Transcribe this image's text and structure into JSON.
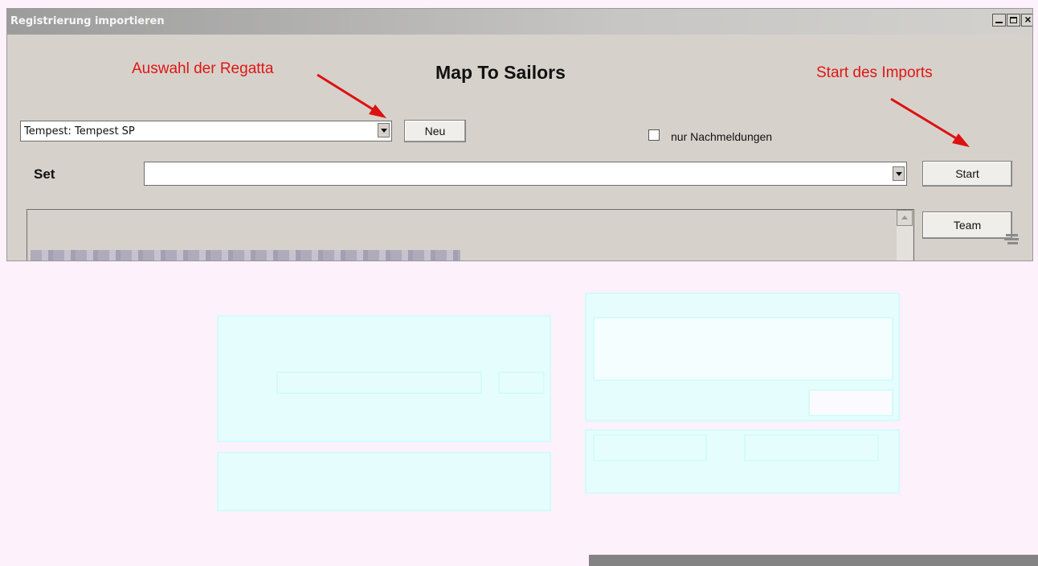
{
  "window": {
    "title": "Registrierung importieren"
  },
  "annotations": {
    "regatta_hint": "Auswahl der Regatta",
    "import_hint": "Start des Imports",
    "color": "#e01515"
  },
  "heading": "Map To Sailors",
  "regatta_select": {
    "value": "Tempest:  Tempest SP"
  },
  "buttons": {
    "new": "Neu",
    "start": "Start",
    "team": "Team"
  },
  "checkbox": {
    "label": "nur Nachmeldungen",
    "checked": false
  },
  "set": {
    "label": "Set",
    "value": ""
  },
  "icons": [
    "minimize-icon",
    "maximize-icon",
    "close-icon",
    "dropdown-arrow-icon",
    "scroll-up-icon",
    "resize-grip-icon"
  ]
}
